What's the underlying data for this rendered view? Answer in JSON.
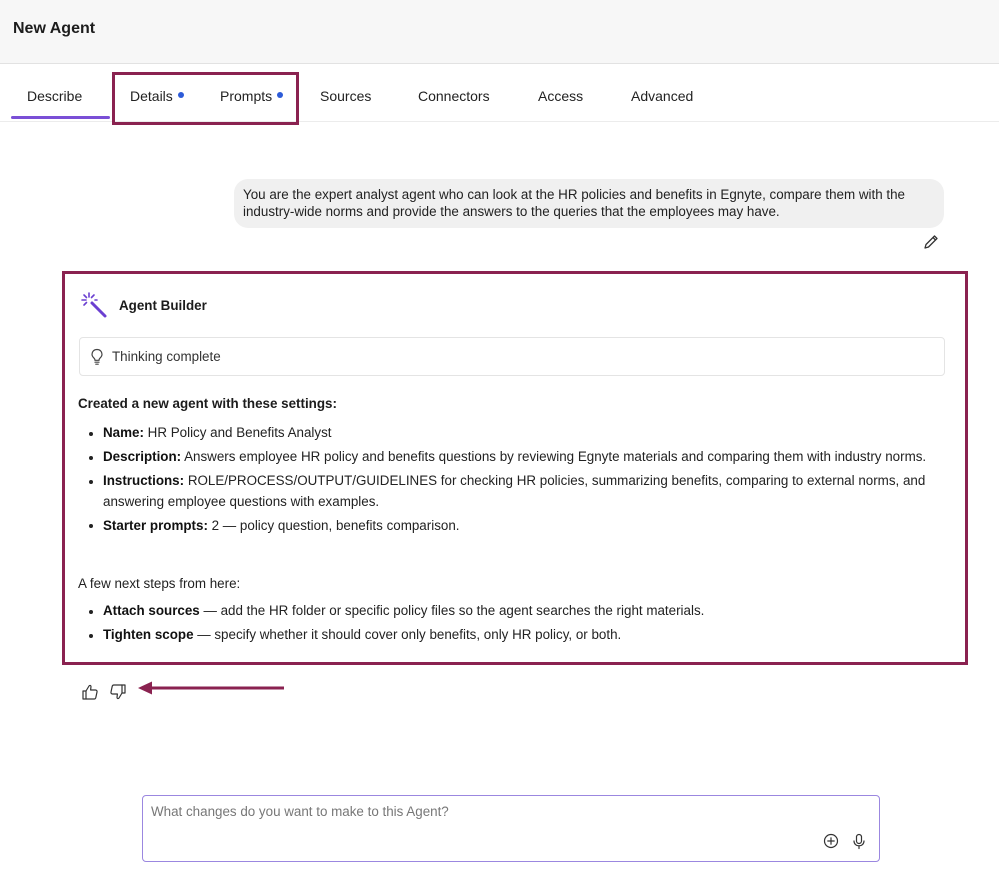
{
  "header": {
    "title": "New Agent"
  },
  "tabs": [
    {
      "label": "Describe",
      "active": true,
      "dot": false
    },
    {
      "label": "Details",
      "active": false,
      "dot": true
    },
    {
      "label": "Prompts",
      "active": false,
      "dot": true
    },
    {
      "label": "Sources",
      "active": false,
      "dot": false
    },
    {
      "label": "Connectors",
      "active": false,
      "dot": false
    },
    {
      "label": "Access",
      "active": false,
      "dot": false
    },
    {
      "label": "Advanced",
      "active": false,
      "dot": false
    }
  ],
  "user_message": "You are the expert analyst agent who can look at the HR policies and benefits in Egnyte, compare them with the industry-wide norms and provide the answers to the queries that the employees may have.",
  "response": {
    "author": "Agent Builder",
    "thinking_status": "Thinking complete",
    "heading": "Created a new agent with these settings:",
    "settings": [
      {
        "key": "Name:",
        "value": " HR Policy and Benefits Analyst"
      },
      {
        "key": "Description:",
        "value": " Answers employee HR policy and benefits questions by reviewing Egnyte materials and comparing them with industry norms."
      },
      {
        "key": "Instructions:",
        "value": " ROLE/PROCESS/OUTPUT/GUIDELINES for checking HR policies, summarizing benefits, comparing to external norms, and answering employee questions with examples."
      },
      {
        "key": "Starter prompts:",
        "value": " 2 — policy question, benefits comparison."
      }
    ],
    "next_steps_intro": "A few next steps from here:",
    "next_steps": [
      {
        "key": "Attach sources",
        "value": " — add the HR folder or specific policy files so the agent searches the right materials."
      },
      {
        "key": "Tighten scope",
        "value": " — specify whether it should cover only benefits, only HR policy, or both."
      }
    ]
  },
  "feedback": {
    "up_icon": "thumbs-up-icon",
    "down_icon": "thumbs-down-icon"
  },
  "composer": {
    "placeholder": "What changes do you want to make to this Agent?",
    "value": "",
    "add_icon": "plus-circle-icon",
    "mic_icon": "microphone-icon"
  },
  "colors": {
    "accent": "#7a4fd6",
    "annotation": "#8a2250",
    "dot": "#2d5bd8",
    "composer_border": "#9b87e0"
  }
}
